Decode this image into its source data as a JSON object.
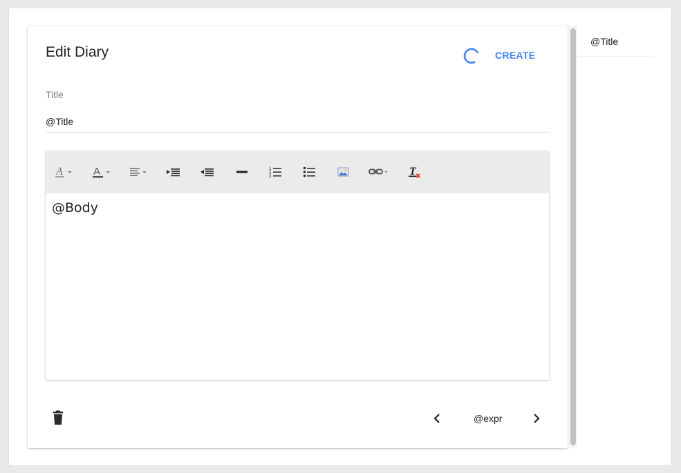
{
  "dialog": {
    "title": "Edit Diary",
    "create_label": "CREATE",
    "accent_color": "#4285f4",
    "icon_spinner": "loading-spinner-icon"
  },
  "form": {
    "title_label": "Title",
    "title_value": "@Title"
  },
  "editor": {
    "body": "@Body",
    "toolbar_icons": [
      "font-style-icon",
      "text-color-icon",
      "align-icon",
      "indent-icon",
      "outdent-icon",
      "horizontal-rule-icon",
      "ordered-list-icon",
      "bullet-list-icon",
      "image-icon",
      "link-icon",
      "clear-format-icon"
    ]
  },
  "footer": {
    "delete_icon": "trash-icon",
    "prev_icon": "chevron-left-icon",
    "next_icon": "chevron-right-icon",
    "pager_text": "@expr"
  },
  "side_list": {
    "items": [
      {
        "label": "@Title"
      }
    ]
  }
}
